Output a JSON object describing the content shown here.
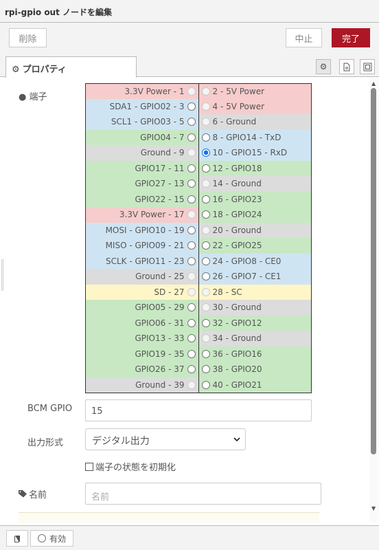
{
  "title": "rpi-gpio out ノードを編集",
  "buttons": {
    "delete": "削除",
    "cancel": "中止",
    "done": "完了"
  },
  "tab": {
    "label": "プロパティ"
  },
  "pins": {
    "label": "端子",
    "rows": [
      {
        "left": "3.3V Power - 1",
        "leftColor": "#f6cccc",
        "leftState": "disabled",
        "right": "2 - 5V Power",
        "rightColor": "#f6cccc",
        "rightState": "disabled"
      },
      {
        "left": "SDA1 - GPIO02 - 3",
        "leftColor": "#cfe4f2",
        "leftState": "enabled",
        "right": "4 - 5V Power",
        "rightColor": "#f6cccc",
        "rightState": "disabled"
      },
      {
        "left": "SCL1 - GPIO03 - 5",
        "leftColor": "#cfe4f2",
        "leftState": "enabled",
        "right": "6 - Ground",
        "rightColor": "#dcdcdc",
        "rightState": "disabled"
      },
      {
        "left": "GPIO04 - 7",
        "leftColor": "#c7e8c3",
        "leftState": "enabled",
        "right": "8 - GPIO14 - TxD",
        "rightColor": "#cfe4f2",
        "rightState": "enabled"
      },
      {
        "left": "Ground - 9",
        "leftColor": "#dcdcdc",
        "leftState": "disabled",
        "right": "10 - GPIO15 - RxD",
        "rightColor": "#cfe4f2",
        "rightState": "checked"
      },
      {
        "left": "GPIO17 - 11",
        "leftColor": "#c7e8c3",
        "leftState": "enabled",
        "right": "12 - GPIO18",
        "rightColor": "#c7e8c3",
        "rightState": "enabled"
      },
      {
        "left": "GPIO27 - 13",
        "leftColor": "#c7e8c3",
        "leftState": "enabled",
        "right": "14 - Ground",
        "rightColor": "#dcdcdc",
        "rightState": "disabled"
      },
      {
        "left": "GPIO22 - 15",
        "leftColor": "#c7e8c3",
        "leftState": "enabled",
        "right": "16 - GPIO23",
        "rightColor": "#c7e8c3",
        "rightState": "enabled"
      },
      {
        "left": "3.3V Power - 17",
        "leftColor": "#f6cccc",
        "leftState": "disabled",
        "right": "18 - GPIO24",
        "rightColor": "#c7e8c3",
        "rightState": "enabled"
      },
      {
        "left": "MOSI - GPIO10 - 19",
        "leftColor": "#cfe4f2",
        "leftState": "enabled",
        "right": "20 - Ground",
        "rightColor": "#dcdcdc",
        "rightState": "disabled"
      },
      {
        "left": "MISO - GPIO09 - 21",
        "leftColor": "#cfe4f2",
        "leftState": "enabled",
        "right": "22 - GPIO25",
        "rightColor": "#c7e8c3",
        "rightState": "enabled"
      },
      {
        "left": "SCLK - GPIO11 - 23",
        "leftColor": "#cfe4f2",
        "leftState": "enabled",
        "right": "24 - GPIO8 - CE0",
        "rightColor": "#cfe4f2",
        "rightState": "enabled"
      },
      {
        "left": "Ground - 25",
        "leftColor": "#dcdcdc",
        "leftState": "disabled",
        "right": "26 - GPIO7 - CE1",
        "rightColor": "#cfe4f2",
        "rightState": "enabled"
      },
      {
        "left": "SD - 27",
        "leftColor": "#fff6c7",
        "leftState": "disabled",
        "right": "28 - SC",
        "rightColor": "#fff6c7",
        "rightState": "disabled"
      },
      {
        "left": "GPIO05 - 29",
        "leftColor": "#c7e8c3",
        "leftState": "enabled",
        "right": "30 - Ground",
        "rightColor": "#dcdcdc",
        "rightState": "disabled"
      },
      {
        "left": "GPIO06 - 31",
        "leftColor": "#c7e8c3",
        "leftState": "enabled",
        "right": "32 - GPIO12",
        "rightColor": "#c7e8c3",
        "rightState": "enabled"
      },
      {
        "left": "GPIO13 - 33",
        "leftColor": "#c7e8c3",
        "leftState": "enabled",
        "right": "34 - Ground",
        "rightColor": "#dcdcdc",
        "rightState": "disabled"
      },
      {
        "left": "GPIO19 - 35",
        "leftColor": "#c7e8c3",
        "leftState": "enabled",
        "right": "36 - GPIO16",
        "rightColor": "#c7e8c3",
        "rightState": "enabled"
      },
      {
        "left": "GPIO26 - 37",
        "leftColor": "#c7e8c3",
        "leftState": "enabled",
        "right": "38 - GPIO20",
        "rightColor": "#c7e8c3",
        "rightState": "enabled"
      },
      {
        "left": "Ground - 39",
        "leftColor": "#dcdcdc",
        "leftState": "disabled",
        "right": "40 - GPIO21",
        "rightColor": "#c7e8c3",
        "rightState": "enabled"
      }
    ]
  },
  "bcm": {
    "label": "BCM GPIO",
    "value": "15"
  },
  "outputType": {
    "label": "出力形式",
    "selected": "デジタル出力"
  },
  "initialize": {
    "label": "端子の状態を初期化",
    "checked": false
  },
  "name": {
    "label": "名前",
    "placeholder": "名前",
    "value": ""
  },
  "footer": {
    "enabled_label": "有効"
  },
  "colors": {
    "accent": "#ad1625",
    "selected_radio": "#1a73e8"
  }
}
